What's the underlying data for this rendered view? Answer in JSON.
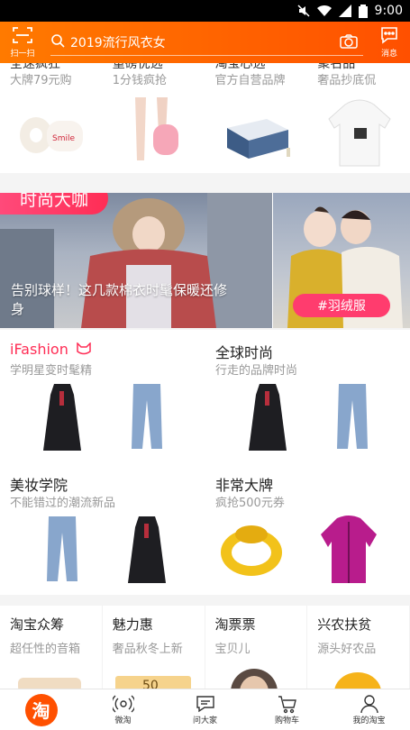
{
  "status": {
    "time": "9:00"
  },
  "header": {
    "scan_label": "扫一扫",
    "search_query": "2019流行风衣女",
    "message_label": "消息"
  },
  "top_row": {
    "items": [
      {
        "cut_title": "全速疯狂",
        "subtitle": "大牌79元购"
      },
      {
        "cut_title": "重磅优选",
        "subtitle": "1分钱疯抢"
      },
      {
        "cut_title": "淘宝心选",
        "subtitle": "官方自营品牌"
      },
      {
        "cut_title": "聚名品",
        "subtitle": "奢品抄底侃"
      }
    ]
  },
  "fashion": {
    "tag": "时尚大咖",
    "caption": "告别球样！这几款棉衣时髦保暖还修身",
    "hashtag": "#羽绒服"
  },
  "grid": [
    {
      "title": "iFashion",
      "subtitle": "学明星变时髦精"
    },
    {
      "title": "全球时尚",
      "subtitle": "行走的品牌时尚"
    },
    {
      "title": "美妆学院",
      "subtitle": "不能错过的潮流新品"
    },
    {
      "title": "非常大牌",
      "subtitle": "疯抢500元券"
    }
  ],
  "bottom_row": [
    {
      "title": "淘宝众筹",
      "subtitle": "超任性的音箱"
    },
    {
      "title": "魅力惠",
      "subtitle": "奢品秋冬上新"
    },
    {
      "title": "淘票票",
      "subtitle": "宝贝儿"
    },
    {
      "title": "兴农扶贫",
      "subtitle": "源头好农品"
    }
  ],
  "tabs": [
    {
      "label": "淘",
      "name": "home"
    },
    {
      "label": "微淘",
      "name": "weitao"
    },
    {
      "label": "问大家",
      "name": "ask"
    },
    {
      "label": "购物车",
      "name": "cart"
    },
    {
      "label": "我的淘宝",
      "name": "mine"
    }
  ],
  "colors": {
    "brand": "#ff5000",
    "accent": "#ff2d55",
    "text_muted": "#999999"
  }
}
